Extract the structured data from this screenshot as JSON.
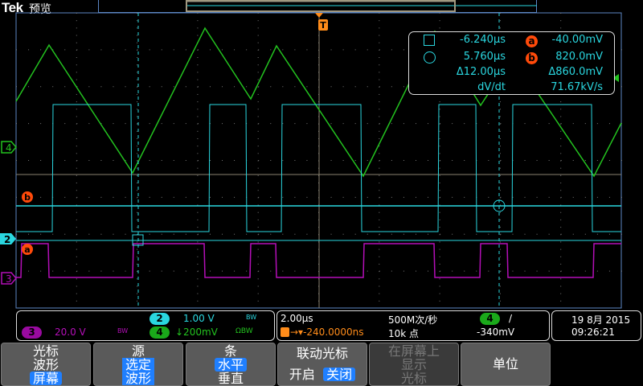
{
  "header": {
    "brand": "Tek",
    "mode": "预览"
  },
  "colors": {
    "ch2": "#2ad7e0",
    "ch3": "#b40fb8",
    "ch4": "#23c21f",
    "trigger": "#ff8c1a",
    "cursor": "#2ad7e0",
    "cursor_marker": "#ff4a0a"
  },
  "markers": {
    "trigger": "T",
    "ch4": "4",
    "ch2": "2",
    "ch3": "3",
    "cursor_a": "a",
    "cursor_b": "b"
  },
  "measurements": {
    "t1": "-6.240µs",
    "t2": "5.760µs",
    "dt": "Δ12.00µs",
    "va": "-40.00mV",
    "vb": "820.0mV",
    "dv": "Δ860.0mV",
    "slope_label": "dV/dt",
    "slope": "71.67kV/s",
    "a_label": "a",
    "b_label": "b"
  },
  "channels": {
    "ch2": {
      "num": "2",
      "scale": "1.00 V",
      "bw": "BW"
    },
    "ch3": {
      "num": "3",
      "scale": "20.0 V",
      "bw": "BW"
    },
    "ch4": {
      "num": "4",
      "scale": "↓200mV",
      "bw": "ΩBW"
    }
  },
  "horizontal": {
    "scale": "2.00µs",
    "position": "→▾-240.0000ns",
    "sample_rate": "500M次/秒",
    "record": "10k 点"
  },
  "trigger": {
    "source": "4",
    "slope": "/",
    "level": "-340mV"
  },
  "datetime": {
    "date": "19 8月 2015",
    "time": "09:26:21"
  },
  "menu": [
    {
      "title": "光标",
      "line2": "波形",
      "selected": "屏幕"
    },
    {
      "title": "源",
      "sel1": "选定",
      "sel2": "波形"
    },
    {
      "title": "条",
      "selected": "水平",
      "line2": "垂直"
    },
    {
      "title": "联动光标",
      "opt1": "开启",
      "selected": "关闭"
    },
    {
      "line1": "在屏幕上",
      "line2": "显示",
      "line3": "光标"
    },
    {
      "title": "单位"
    }
  ]
}
